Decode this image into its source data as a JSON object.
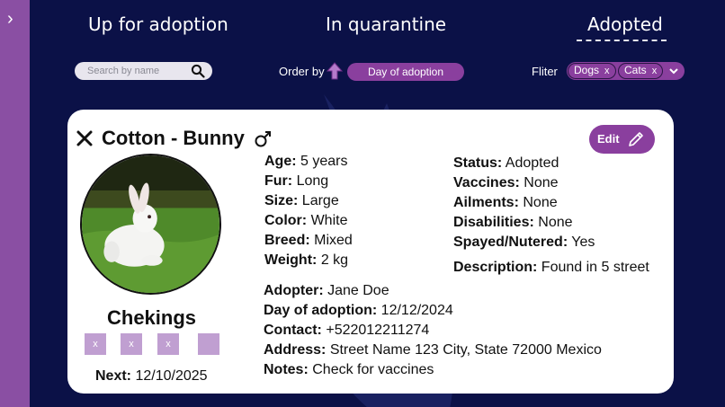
{
  "nav": {
    "toggle_glyph": "›"
  },
  "tabs": [
    {
      "label": "Up for adoption"
    },
    {
      "label": "In quarantine"
    },
    {
      "label": "Adopted"
    }
  ],
  "search": {
    "placeholder": "Search by name"
  },
  "order": {
    "label": "Order by",
    "value": "Day of adoption"
  },
  "filter": {
    "label": "Fliter",
    "chips": [
      {
        "label": "Dogs",
        "remove": "x"
      },
      {
        "label": "Cats",
        "remove": "x"
      }
    ]
  },
  "pet": {
    "title": "Cotton - Bunny",
    "edit_label": "Edit",
    "shelter_name": "Chekings",
    "checkboxes": [
      "x",
      "x",
      "x",
      ""
    ],
    "next_label": "Next:",
    "next_value": "12/10/2025",
    "left_fields": [
      {
        "label": "Age:",
        "value": "5 years"
      },
      {
        "label": "Fur:",
        "value": "Long"
      },
      {
        "label": "Size:",
        "value": "Large"
      },
      {
        "label": "Color:",
        "value": "White"
      },
      {
        "label": "Breed:",
        "value": "Mixed"
      },
      {
        "label": "Weight:",
        "value": "2 kg"
      }
    ],
    "right_fields": [
      {
        "label": "Status:",
        "value": "Adopted"
      },
      {
        "label": "Vaccines:",
        "value": "None"
      },
      {
        "label": "Ailments:",
        "value": "None"
      },
      {
        "label": "Disabilities:",
        "value": "None"
      },
      {
        "label": "Spayed/Nutered:",
        "value": "Yes"
      },
      {
        "label": "Description:",
        "value": "Found in 5 street"
      }
    ],
    "adoption_fields": [
      {
        "label": "Adopter:",
        "value": "Jane Doe"
      },
      {
        "label": "Day of adoption:",
        "value": "12/12/2024"
      },
      {
        "label": "Contact:",
        "value": "+522012211274"
      },
      {
        "label": "Address:",
        "value": "Street Name 123 City, State 72000 Mexico"
      },
      {
        "label": "Notes:",
        "value": "Check for vaccines"
      }
    ]
  },
  "colors": {
    "background": "#0b1147",
    "accent": "#8a3f9e",
    "rail": "#8a4fa3",
    "checkbox": "#c09fd1"
  }
}
